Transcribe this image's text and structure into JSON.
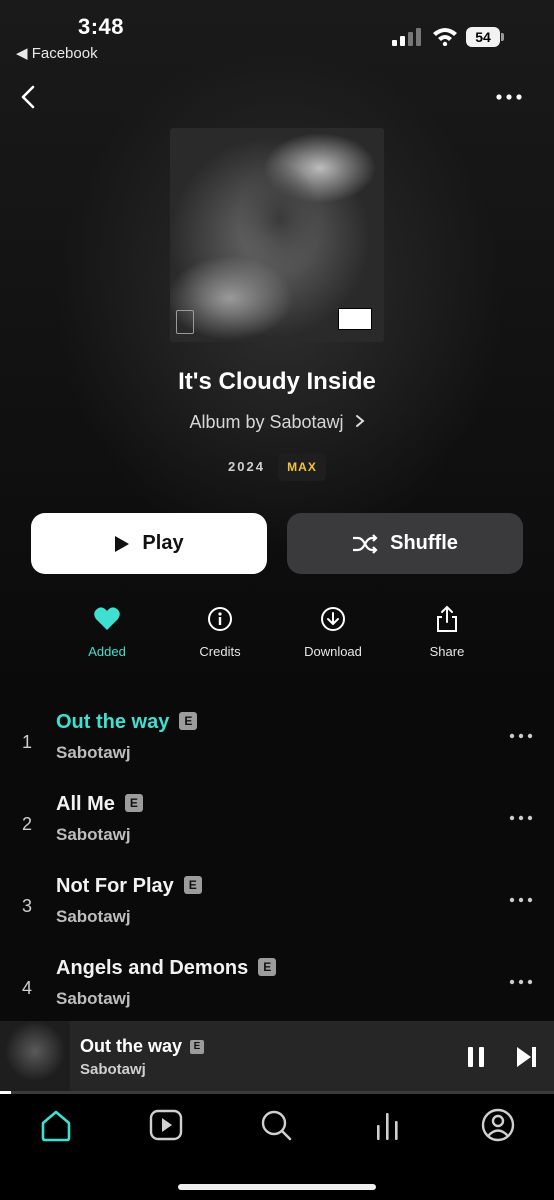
{
  "status_bar": {
    "time": "3:48",
    "back_app_label": "◀ Facebook",
    "battery_level": "54"
  },
  "album": {
    "title": "It's Cloudy Inside",
    "subtitle": "Album by Sabotawj",
    "year": "2024",
    "quality_badge": "MAX"
  },
  "buttons": {
    "play_label": "Play",
    "shuffle_label": "Shuffle"
  },
  "actions": [
    {
      "label": "Added",
      "icon": "heart-icon",
      "active": true
    },
    {
      "label": "Credits",
      "icon": "info-icon"
    },
    {
      "label": "Download",
      "icon": "download-icon"
    },
    {
      "label": "Share",
      "icon": "share-icon"
    }
  ],
  "tracks": [
    {
      "number": "1",
      "title": "Out the way",
      "explicit": "E",
      "artist": "Sabotawj",
      "playing": true
    },
    {
      "number": "2",
      "title": "All Me",
      "explicit": "E",
      "artist": "Sabotawj"
    },
    {
      "number": "3",
      "title": "Not For Play",
      "explicit": "E",
      "artist": "Sabotawj"
    },
    {
      "number": "4",
      "title": "Angels and Demons",
      "explicit": "E",
      "artist": "Sabotawj"
    }
  ],
  "now_playing": {
    "title": "Out the way",
    "explicit": "E",
    "artist": "Sabotawj",
    "progress_fraction": 0.02
  },
  "tabs": [
    {
      "name": "home",
      "icon": "home-icon",
      "active": true
    },
    {
      "name": "videos",
      "icon": "play-square-icon"
    },
    {
      "name": "search",
      "icon": "search-icon"
    },
    {
      "name": "activity",
      "icon": "bars-icon"
    },
    {
      "name": "profile",
      "icon": "user-circle-icon"
    }
  ],
  "colors": {
    "accent": "#3fe0d0",
    "max_badge": "#f2c33d",
    "background": "#0a0a0a"
  }
}
